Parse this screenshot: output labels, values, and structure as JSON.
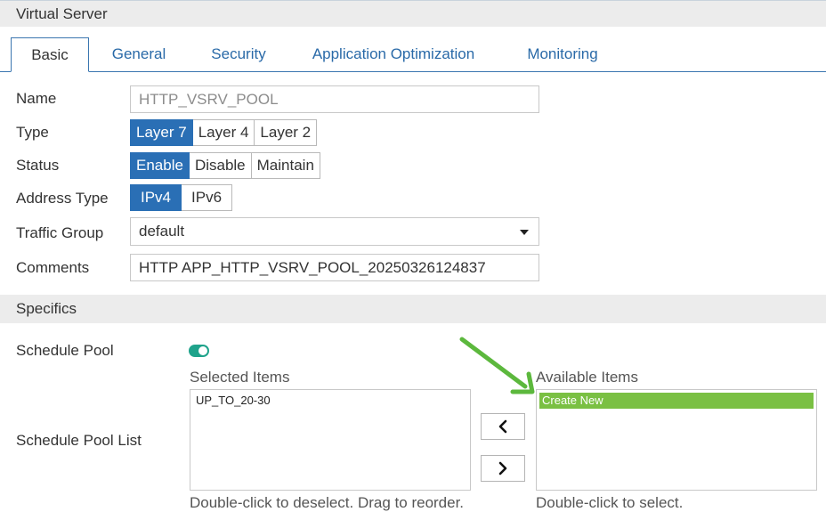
{
  "header": {
    "title": "Virtual Server"
  },
  "tabs": [
    {
      "label": "Basic",
      "active": true
    },
    {
      "label": "General"
    },
    {
      "label": "Security"
    },
    {
      "label": "Application Optimization"
    },
    {
      "label": "Monitoring"
    }
  ],
  "form": {
    "name": {
      "label": "Name",
      "placeholder": "HTTP_VSRV_POOL"
    },
    "type": {
      "label": "Type",
      "options": [
        "Layer 7",
        "Layer 4",
        "Layer 2"
      ],
      "selected": "Layer 7"
    },
    "status": {
      "label": "Status",
      "options": [
        "Enable",
        "Disable",
        "Maintain"
      ],
      "selected": "Enable"
    },
    "address_type": {
      "label": "Address Type",
      "options": [
        "IPv4",
        "IPv6"
      ],
      "selected": "IPv4"
    },
    "traffic_group": {
      "label": "Traffic Group",
      "value": "default"
    },
    "comments": {
      "label": "Comments",
      "value": "HTTP APP_HTTP_VSRV_POOL_20250326124837"
    }
  },
  "specifics": {
    "title": "Specifics",
    "schedule_pool": {
      "label": "Schedule Pool",
      "enabled": true
    },
    "schedule_pool_list": {
      "label": "Schedule Pool List",
      "selected_title": "Selected Items",
      "selected_items": [
        "UP_TO_20-30"
      ],
      "selected_hint": "Double-click to deselect. Drag to reorder.",
      "available_title": "Available Items",
      "available_items": [
        "Create New"
      ],
      "available_hint": "Double-click to select.",
      "move_left_icon": "chevron-left-icon",
      "move_right_icon": "chevron-right-icon"
    }
  },
  "colors": {
    "accent": "#2a6fb5",
    "toggle_on": "#1fa38b",
    "highlight_item": "#7ac043",
    "annotation_arrow": "#5cb83d"
  }
}
